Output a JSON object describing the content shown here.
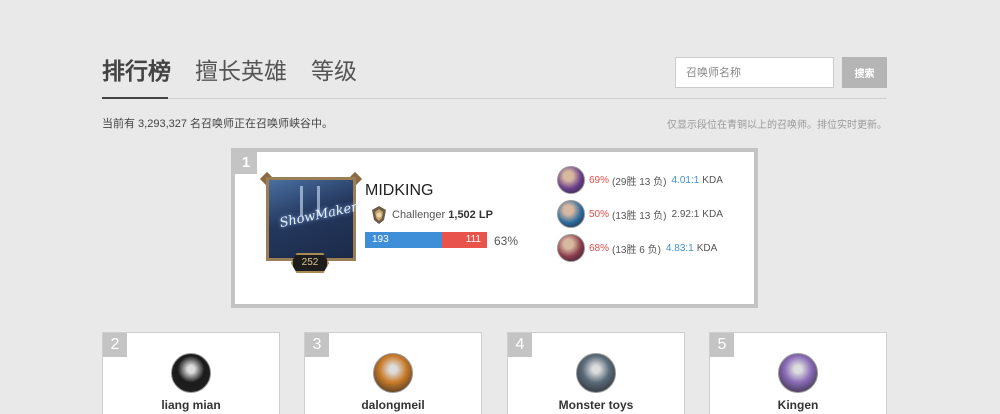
{
  "tabs": [
    {
      "label": "排行榜",
      "active": true
    },
    {
      "label": "擅长英雄",
      "active": false
    },
    {
      "label": "等级",
      "active": false
    }
  ],
  "search": {
    "placeholder": "召唤师名称",
    "button_label": "搜索"
  },
  "summary": {
    "count_text": "当前有 3,293,327 名召唤师正在召唤师峡谷中。",
    "note_text": "仅显示段位在青铜以上的召唤师。排位实时更新。"
  },
  "featured": {
    "rank": "1",
    "name": "MIDKING",
    "level": "252",
    "portrait_signature": "ShowMaker",
    "tier": "Challenger",
    "lp": "1,502 LP",
    "wins": "193",
    "losses": "111",
    "win_fraction": 0.63,
    "win_rate": "63%",
    "champions": [
      {
        "pct": "69%",
        "record": "(29胜 13 负)",
        "kda": "4.01:1",
        "kda_color": "blue",
        "kda_suffix": "KDA",
        "icon": "champion-portrait-icon",
        "color": "#6b3f8c"
      },
      {
        "pct": "50%",
        "record": "(13胜 13 负)",
        "kda": "2.92:1",
        "kda_color": "plain",
        "kda_suffix": "KDA",
        "icon": "champion-portrait-icon",
        "color": "#2c6d9e"
      },
      {
        "pct": "68%",
        "record": "(13胜 6 负)",
        "kda": "4.83:1",
        "kda_color": "blue",
        "kda_suffix": "KDA",
        "icon": "champion-portrait-icon",
        "color": "#8a3a4a"
      }
    ]
  },
  "cards": [
    {
      "rank": "2",
      "name": "liang mian",
      "avatar_color": "#1b1b1b",
      "icon": "helmet-icon"
    },
    {
      "rank": "3",
      "name": "dalongmeil",
      "avatar_color": "#c97b2a",
      "icon": "pyramid-icon"
    },
    {
      "rank": "4",
      "name": "Monster toys",
      "avatar_color": "#5a6b7a",
      "icon": "monster-icon"
    },
    {
      "rank": "5",
      "name": "Kingen",
      "avatar_color": "#8a6bb8",
      "icon": "crystal-icon"
    }
  ],
  "colors": {
    "win": "#3e8fd8",
    "loss": "#e8544c",
    "accent_red": "#e0504a"
  }
}
